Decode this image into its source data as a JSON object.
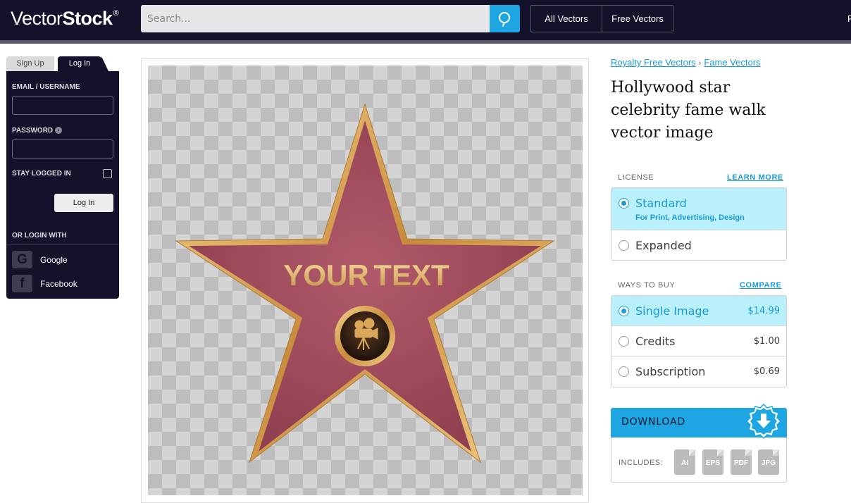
{
  "header": {
    "logo_text_regular": "Vector",
    "logo_text_bold": "Stock",
    "logo_mark": "®",
    "search_placeholder": "Search...",
    "nav": [
      {
        "label": "All Vectors"
      },
      {
        "label": "Free Vectors"
      }
    ],
    "nav_edge_text": "F",
    "search_icon": "search-icon"
  },
  "login": {
    "tabs": {
      "signup": "Sign Up",
      "login": "Log In"
    },
    "email_label": "EMAIL / USERNAME",
    "password_label": "PASSWORD",
    "stay_logged_in_label": "STAY LOGGED IN",
    "login_button": "Log In",
    "or_login_with": "OR LOGIN WITH",
    "social": [
      {
        "label": "Google",
        "icon_letter": "G",
        "icon": "google-icon"
      },
      {
        "label": "Facebook",
        "icon_letter": "f",
        "icon": "facebook-icon"
      }
    ]
  },
  "image": {
    "overlay_text_word1": "YOUR",
    "overlay_text_word2": "TEXT",
    "emblem_icon": "movie-camera-icon"
  },
  "product": {
    "breadcrumb": [
      {
        "label": "Royalty Free Vectors"
      },
      {
        "label": "Fame Vectors"
      }
    ],
    "breadcrumb_separator": "›",
    "title": "Hollywood star celebrity fame walk vector image"
  },
  "license": {
    "label": "LICENSE",
    "link": "LEARN MORE",
    "options": [
      {
        "name": "Standard",
        "sub": "For Print, Advertising, Design",
        "selected": true
      },
      {
        "name": "Expanded",
        "selected": false
      }
    ]
  },
  "buy": {
    "label": "WAYS TO BUY",
    "link": "COMPARE",
    "options": [
      {
        "name": "Single Image",
        "price": "$14.99",
        "selected": true
      },
      {
        "name": "Credits",
        "price": "$1.00",
        "selected": false
      },
      {
        "name": "Subscription",
        "price": "$0.69",
        "selected": false
      }
    ]
  },
  "download": {
    "label": "DOWNLOAD",
    "includes_label": "INCLUDES:",
    "formats": [
      "AI",
      "EPS",
      "PDF",
      "JPG"
    ],
    "badge_icon": "download-arrow-icon"
  },
  "colors": {
    "header_bg": "#14112b",
    "accent": "#1ea6e3",
    "selected_bg": "#baf0fb",
    "star_fill": "#a14a5b",
    "star_border": "#e3b462"
  }
}
